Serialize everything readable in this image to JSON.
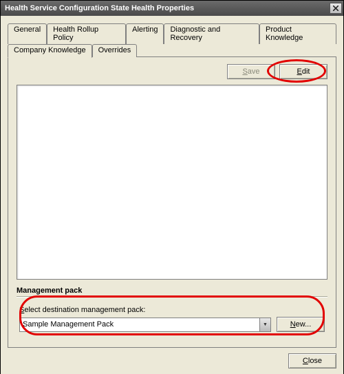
{
  "window": {
    "title": "Health Service Configuration State Health Properties"
  },
  "tabs": {
    "row1": [
      "General",
      "Health Rollup Policy",
      "Alerting",
      "Diagnostic and Recovery",
      "Product Knowledge"
    ],
    "row2": [
      "Company Knowledge",
      "Overrides"
    ],
    "active": "Company Knowledge"
  },
  "buttons": {
    "save": "Save",
    "edit": "Edit",
    "new": "New...",
    "close": "Close"
  },
  "management_pack": {
    "heading": "Management pack",
    "label": "Select destination management pack:",
    "selected": "Sample Management Pack"
  }
}
